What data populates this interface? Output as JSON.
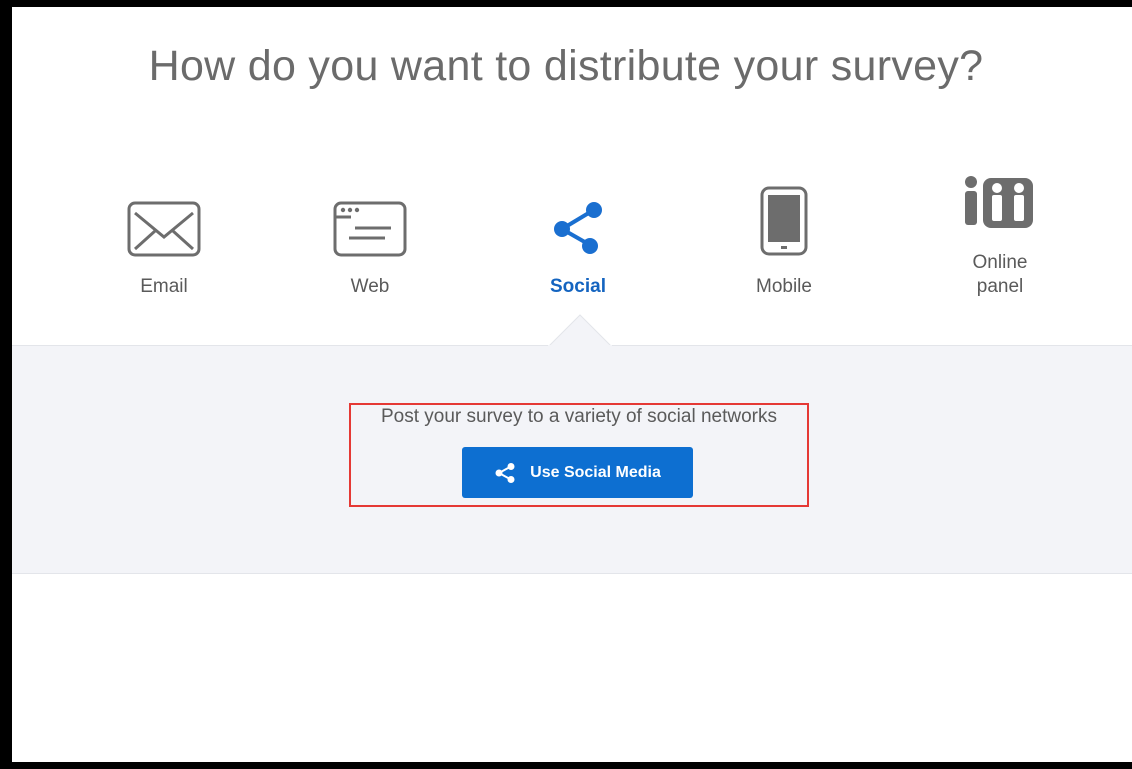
{
  "page": {
    "title": "How do you want to distribute your survey?"
  },
  "options": [
    {
      "id": "email",
      "label": "Email",
      "icon": "envelope-icon",
      "active": false
    },
    {
      "id": "web",
      "label": "Web",
      "icon": "browser-window-icon",
      "active": false
    },
    {
      "id": "social",
      "label": "Social",
      "icon": "share-icon",
      "active": true
    },
    {
      "id": "mobile",
      "label": "Mobile",
      "icon": "mobile-phone-icon",
      "active": false
    },
    {
      "id": "online-panel",
      "label_line1": "Online",
      "label_line2": "panel",
      "icon": "people-panel-icon",
      "active": false
    }
  ],
  "panel": {
    "description": "Post your survey to a variety of social networks",
    "button_label": "Use Social Media",
    "button_icon": "share-icon"
  },
  "colors": {
    "accent": "#0d6fd1",
    "active_label": "#1464c0",
    "icon_gray": "#6d6d6d",
    "highlight_border": "#e53935",
    "panel_bg": "#f3f4f8"
  }
}
